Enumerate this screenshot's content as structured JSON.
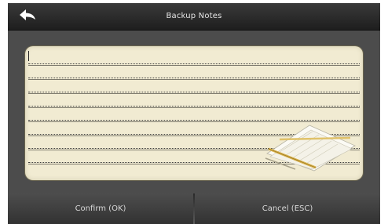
{
  "window": {
    "title": "Backup Notes"
  },
  "back_icon": "back-arrow-icon",
  "note": {
    "value": ""
  },
  "footer": {
    "confirm_label": "Confirm (OK)",
    "cancel_label": "Cancel (ESC)"
  },
  "colors": {
    "title_bar": "#2a2a2a",
    "background": "#4c4c4c",
    "note_pad": "#f1ebd2",
    "text": "#e6e6e6"
  }
}
